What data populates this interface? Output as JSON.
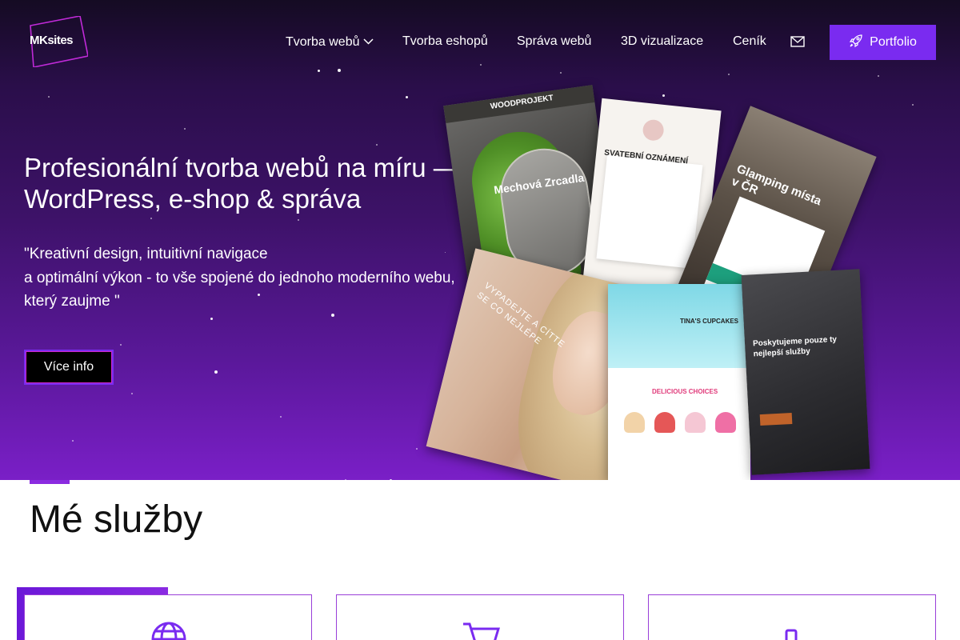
{
  "logo": {
    "text": "MKsites"
  },
  "nav": {
    "items": [
      {
        "label": "Tvorba webů",
        "has_dropdown": true
      },
      {
        "label": "Tvorba eshopů"
      },
      {
        "label": "Správa webů"
      },
      {
        "label": "3D vizualizace"
      },
      {
        "label": "Ceník"
      }
    ],
    "contact_icon": "mail-icon",
    "portfolio_label": "Portfolio",
    "portfolio_icon": "rocket-icon"
  },
  "hero": {
    "title": "Profesionální tvorba webů na míru — WordPress, e-shop & správa",
    "quote_lines": [
      "\"Kreativní design, intuitivní navigace",
      "a optimální výkon - to vše spojené do jednoho moderního webu,",
      "který zaujme \""
    ],
    "more_label": "Více info",
    "collage_texts": {
      "wood_brand": "WOODPROJEKT",
      "wood_heading": "Mechová Zrcadla",
      "invite_heading": "SVATEBNÍ OZNÁMENÍ",
      "glamping_heading": "Glamping místa v ČR",
      "beauty_heading": "VYPADEJTE A CÍTTE SE CO NEJLÉPE",
      "cupcakes_heading": "TINA'S CUPCAKES",
      "cupcakes_sub": "DELICIOUS CHOICES",
      "barber_heading": "Poskytujeme pouze ty nejlepší služby"
    }
  },
  "services": {
    "title": "Mé služby",
    "cards": [
      {
        "icon": "globe-icon"
      },
      {
        "icon": "cart-icon"
      },
      {
        "icon": "phone-icon"
      }
    ]
  },
  "colors": {
    "accent": "#7a2bf0",
    "hero_top": "#150b23",
    "hero_bottom": "#7a1fc7",
    "card_border": "#9a3fd9"
  }
}
